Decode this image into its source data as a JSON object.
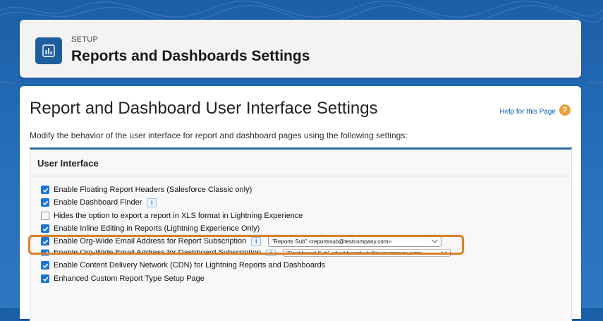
{
  "header": {
    "eyebrow": "SETUP",
    "title": "Reports and Dashboards Settings",
    "icon": "report-chart-icon"
  },
  "page": {
    "title": "Report and Dashboard User Interface Settings",
    "help_link": "Help for this Page",
    "help_icon": "question-icon",
    "description": "Modify the behavior of the user interface for report and dashboard pages using the following settings:"
  },
  "section": {
    "title": "User Interface",
    "options": [
      {
        "label": "Enable Floating Report Headers (Salesforce Classic only)",
        "checked": true
      },
      {
        "label": "Enable Dashboard Finder",
        "checked": true,
        "info": true
      },
      {
        "label": "Hides the option to export a report in XLS format in Lightning Experience",
        "checked": false
      },
      {
        "label": "Enable Inline Editing in Reports (Lightning Experience Only)",
        "checked": true
      },
      {
        "label": "Enable Org-Wide Email Address for Report Subscription",
        "checked": true,
        "info": true,
        "select": "\"Reports Sub\" <reportssub@testcompany.com>"
      },
      {
        "label": "Enable Org-Wide Email Address for Dashboard Subscription",
        "checked": true,
        "info": true,
        "select": "\"Dashboard Sub\" <dashboardsub@testcompany.com>"
      },
      {
        "label": "Enable Content Delivery Network (CDN) for Lightning Reports and Dashboards",
        "checked": true
      },
      {
        "label": "Enhanced Custom Report Type Setup Page",
        "checked": true
      }
    ]
  },
  "colors": {
    "brand": "#1f5e9c",
    "checkbox": "#1b73d6",
    "highlight": "#d9822b",
    "section_border": "#2e6a9e"
  }
}
